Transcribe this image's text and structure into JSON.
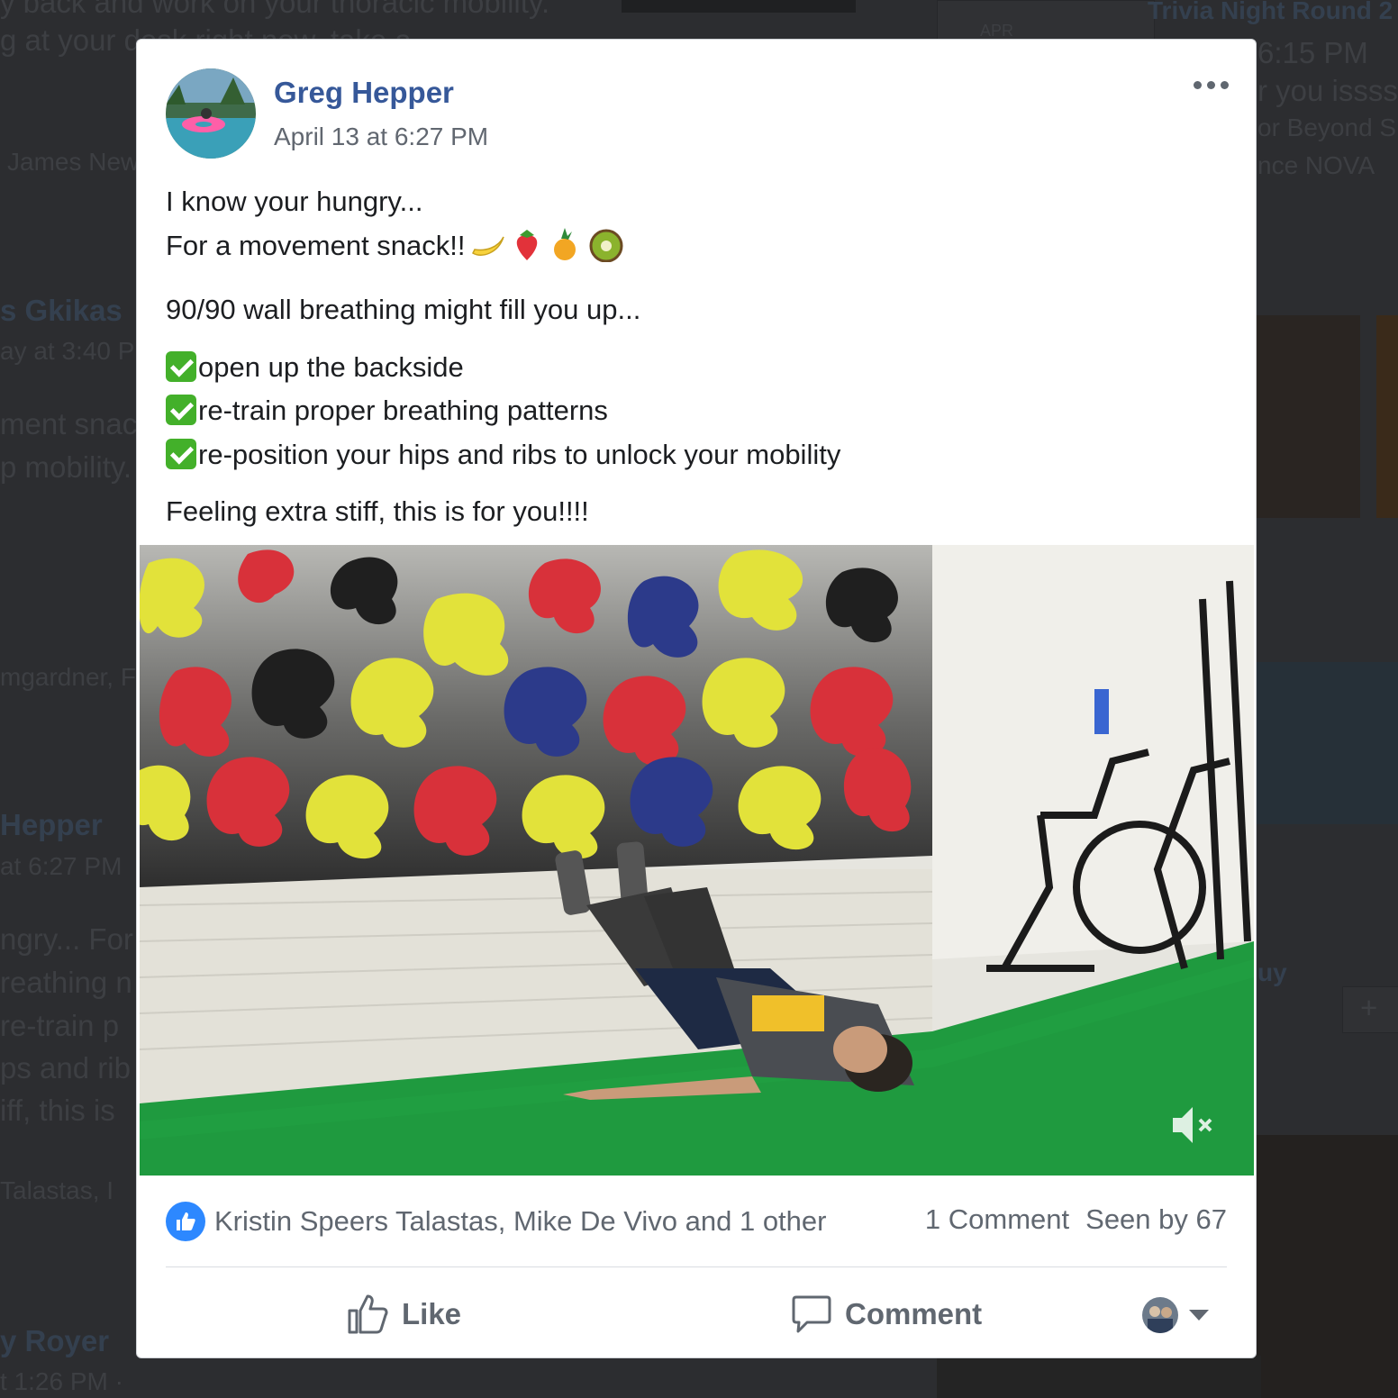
{
  "background": {
    "feed_fragments": [
      "y back and work on your thoracic mobility.",
      "g at your desk right now, take a",
      "James New",
      "s Gkikas",
      "ay at 3:40 P",
      "ment snac",
      "p mobility.",
      "mgardner, F",
      "Hepper",
      "at 6:27 PM",
      "ngry... For",
      "reathing n",
      "re-train p",
      "ps and rib",
      "iff, this is",
      "Talastas, I",
      "y Royer",
      "t 1:26 PM ·",
      "Trivia Night Round 2",
      "6:15 PM",
      "r you issss",
      "or Beyond S",
      "nce NOVA",
      "uy",
      "APR",
      "+"
    ]
  },
  "post": {
    "author": "Greg Hepper",
    "timestamp": "April 13 at 6:27 PM",
    "more_icon": "more-horizontal-icon",
    "body": {
      "line1": "I know your hungry...",
      "line2": "For a movement snack!!",
      "emojis": [
        "banana",
        "strawberry",
        "pineapple",
        "kiwi"
      ],
      "line3": "90/90 wall breathing might fill you up...",
      "bullets": [
        "open up the backside",
        "re-train proper breathing patterns",
        "re-position your hips and ribs to unlock your mobility"
      ],
      "closing": "Feeling extra stiff, this is for you!!!!"
    },
    "video": {
      "muted": true,
      "mute_icon": "volume-muted-icon"
    },
    "reactions": {
      "icon": "like-reaction-icon",
      "names": "Kristin Speers Talastas, Mike De Vivo and 1 other",
      "comments": "1 Comment",
      "seen": "Seen by 67"
    },
    "actions": {
      "like_label": "Like",
      "comment_label": "Comment"
    }
  },
  "colors": {
    "author_link": "#365899",
    "like_blue": "#2d88ff",
    "muted_text": "#606770",
    "check_green": "#43b02a",
    "turf_green": "#1f9a3f"
  }
}
